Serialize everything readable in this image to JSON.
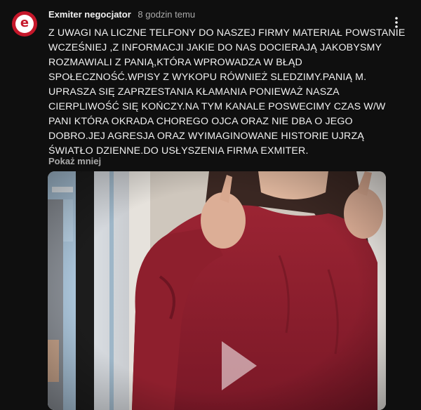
{
  "post": {
    "author": "Exmiter negocjator",
    "time": "8 godzin temu",
    "text": "Z UWAGI NA LICZNE TELFONY DO NASZEJ FIRMY MATERIAŁ POWSTANIE WCZEŚNIEJ ,Z INFORMACJI JAKIE DO  NAS DOCIERAJĄ JAKOBYSMY ROZMAWIALI Z PANIĄ,KTÓRA WPROWADZA W BŁĄD SPOŁECZNOŚĆ.WPISY Z WYKOPU RÓWNIEŻ SLEDZIMY.PANIĄ  M. UPRASZA SIĘ ZAPRZESTANIA KŁAMANIA PONIEWAŻ NASZA CIERPLIWOŚĆ SIĘ KOŃCZY.NA TYM KANALE POSWECIMY CZAS W/W PANI KTÓRA OKRADA CHOREGO OJCA ORAZ NIE DBA O JEGO DOBRO.JEJ AGRESJA ORAZ WYIMAGINOWANE HISTORIE UJRZĄ ŚWIATŁO DZIENNE.DO USŁYSZENIA FIRMA EXMITER.",
    "show_less": "Pokaż mniej",
    "avatar_letter": "e"
  },
  "icons": {
    "menu": "more-vert-icon",
    "play": "play-icon"
  },
  "colors": {
    "background": "#0f0f0f",
    "avatar_red": "#c5172a",
    "secondary_text": "#aaaaaa",
    "shirt": "#8e1f2d"
  }
}
